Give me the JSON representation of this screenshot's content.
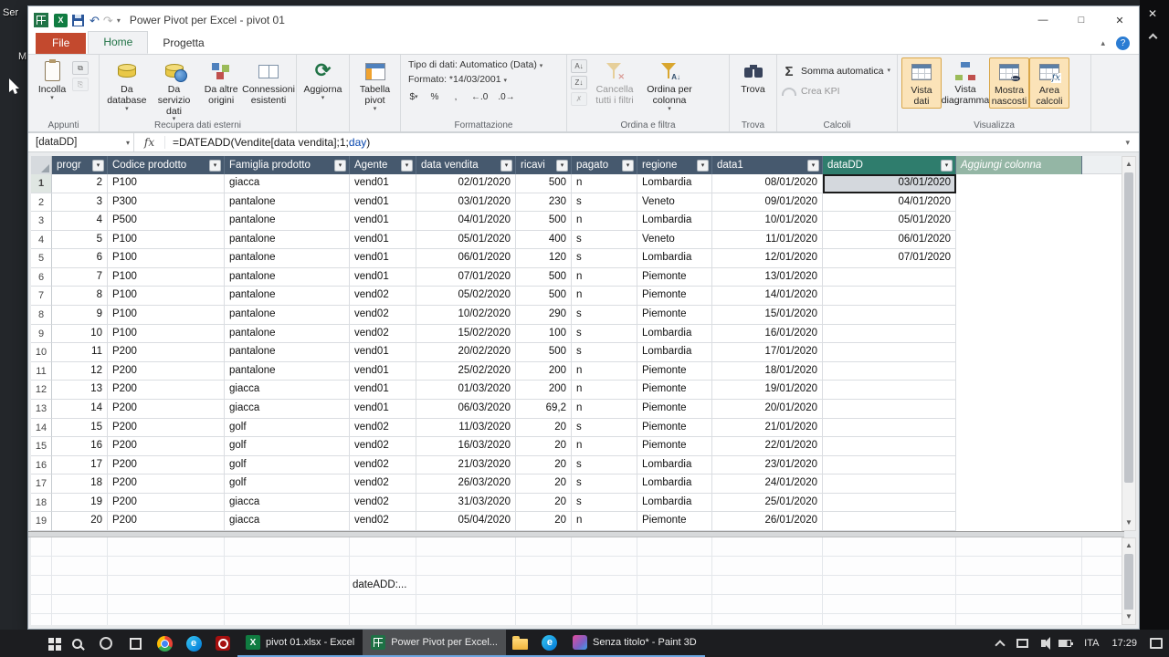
{
  "desktop": {
    "labels": [
      "Ser",
      "M"
    ]
  },
  "window": {
    "title": "Power Pivot per Excel - pivot 01",
    "controls": {
      "minimize": "—",
      "maximize": "□",
      "close": "✕"
    }
  },
  "tabs": [
    "File",
    "Home",
    "Progetta"
  ],
  "ribbon": {
    "group_labels": [
      "Appunti",
      "Recupera dati esterni",
      "Formattazione",
      "Ordina e filtra",
      "Trova",
      "Calcoli",
      "Visualizza"
    ],
    "buttons": {
      "incolla": "Incolla",
      "da_database": "Da database",
      "da_servizio": "Da servizio dati",
      "da_altre": "Da altre origini",
      "connessioni": "Connessioni esistenti",
      "aggiorna": "Aggiorna",
      "tabella_pivot": "Tabella pivot",
      "tipo_dati": "Tipo di dati: Automatico (Data)",
      "formato": "Formato: *14/03/2001",
      "cancella_filtri": "Cancella tutti i filtri",
      "ordina_colonna": "Ordina per colonna",
      "trova": "Trova",
      "somma_automatica": "Somma automatica",
      "crea_kpi": "Crea KPI",
      "vista_dati": "Vista dati",
      "vista_diagramma": "Vista diagramma",
      "mostra_nascosti": "Mostra nascosti",
      "area_calcoli": "Area calcoli"
    }
  },
  "formula_bar": {
    "name_box": "[dataDD]",
    "fx": "fx",
    "segments": [
      {
        "text": "=DATEADD(Vendite[data vendita];1;",
        "color": "#1a1a1a"
      },
      {
        "text": "day",
        "color": "#0645ad"
      },
      {
        "text": ")",
        "color": "#1a1a1a"
      }
    ]
  },
  "table": {
    "columns": [
      "progr",
      "Codice prodotto",
      "Famiglia prodotto",
      "Agente",
      "data vendita",
      "ricavi",
      "pagato",
      "regione",
      "data1",
      "dataDD"
    ],
    "add_column_label": "Aggiungi colonna",
    "selected": {
      "row": 1,
      "column": "dataDD",
      "value": "03/01/2020"
    },
    "rows": [
      [
        "2",
        "P100",
        "giacca",
        "vend01",
        "02/01/2020",
        "500",
        "n",
        "Lombardia",
        "08/01/2020",
        "03/01/2020"
      ],
      [
        "3",
        "P300",
        "pantalone",
        "vend01",
        "03/01/2020",
        "230",
        "s",
        "Veneto",
        "09/01/2020",
        "04/01/2020"
      ],
      [
        "4",
        "P500",
        "pantalone",
        "vend01",
        "04/01/2020",
        "500",
        "n",
        "Lombardia",
        "10/01/2020",
        "05/01/2020"
      ],
      [
        "5",
        "P100",
        "pantalone",
        "vend01",
        "05/01/2020",
        "400",
        "s",
        "Veneto",
        "11/01/2020",
        "06/01/2020"
      ],
      [
        "6",
        "P100",
        "pantalone",
        "vend01",
        "06/01/2020",
        "120",
        "s",
        "Lombardia",
        "12/01/2020",
        "07/01/2020"
      ],
      [
        "7",
        "P100",
        "pantalone",
        "vend01",
        "07/01/2020",
        "500",
        "n",
        "Piemonte",
        "13/01/2020",
        ""
      ],
      [
        "8",
        "P100",
        "pantalone",
        "vend02",
        "05/02/2020",
        "500",
        "n",
        "Piemonte",
        "14/01/2020",
        ""
      ],
      [
        "9",
        "P100",
        "pantalone",
        "vend02",
        "10/02/2020",
        "290",
        "s",
        "Piemonte",
        "15/01/2020",
        ""
      ],
      [
        "10",
        "P100",
        "pantalone",
        "vend02",
        "15/02/2020",
        "100",
        "s",
        "Lombardia",
        "16/01/2020",
        ""
      ],
      [
        "11",
        "P200",
        "pantalone",
        "vend01",
        "20/02/2020",
        "500",
        "s",
        "Lombardia",
        "17/01/2020",
        ""
      ],
      [
        "12",
        "P200",
        "pantalone",
        "vend01",
        "25/02/2020",
        "200",
        "n",
        "Piemonte",
        "18/01/2020",
        ""
      ],
      [
        "13",
        "P200",
        "giacca",
        "vend01",
        "01/03/2020",
        "200",
        "n",
        "Piemonte",
        "19/01/2020",
        ""
      ],
      [
        "14",
        "P200",
        "giacca",
        "vend01",
        "06/03/2020",
        "69,2",
        "n",
        "Piemonte",
        "20/01/2020",
        ""
      ],
      [
        "15",
        "P200",
        "golf",
        "vend02",
        "11/03/2020",
        "20",
        "s",
        "Piemonte",
        "21/01/2020",
        ""
      ],
      [
        "16",
        "P200",
        "golf",
        "vend02",
        "16/03/2020",
        "20",
        "n",
        "Piemonte",
        "22/01/2020",
        ""
      ],
      [
        "17",
        "P200",
        "golf",
        "vend02",
        "21/03/2020",
        "20",
        "s",
        "Lombardia",
        "23/01/2020",
        ""
      ],
      [
        "18",
        "P200",
        "golf",
        "vend02",
        "26/03/2020",
        "20",
        "s",
        "Lombardia",
        "24/01/2020",
        ""
      ],
      [
        "19",
        "P200",
        "giacca",
        "vend02",
        "31/03/2020",
        "20",
        "s",
        "Lombardia",
        "25/01/2020",
        ""
      ],
      [
        "20",
        "P200",
        "giacca",
        "vend02",
        "05/04/2020",
        "20",
        "n",
        "Piemonte",
        "26/01/2020",
        ""
      ]
    ]
  },
  "calc_area": {
    "cell_text": "dateADD:..."
  },
  "taskbar": {
    "apps": [
      {
        "label": "pivot 01.xlsx - Excel"
      },
      {
        "label": "Power Pivot per Excel..."
      },
      {
        "label": "Senza titolo* - Paint 3D"
      }
    ],
    "tray": {
      "lang": "ITA",
      "time": "17:29"
    }
  }
}
